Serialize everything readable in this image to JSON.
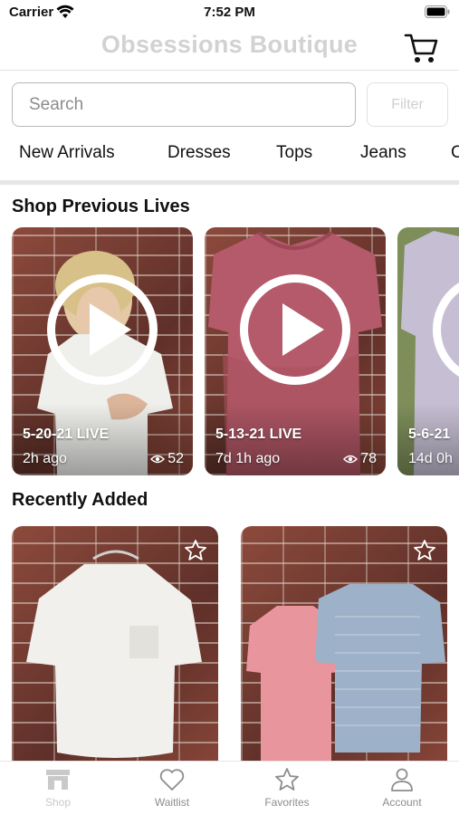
{
  "status_bar": {
    "carrier": "Carrier",
    "time": "7:52 PM"
  },
  "header": {
    "title": "Obsessions Boutique",
    "cart_icon": "cart-icon"
  },
  "search": {
    "placeholder": "Search",
    "value": "",
    "filter_label": "Filter"
  },
  "categories": [
    "New Arrivals",
    "Dresses",
    "Tops",
    "Jeans",
    "C"
  ],
  "sections": {
    "lives_title": "Shop Previous Lives",
    "recent_title": "Recently Added"
  },
  "lives": [
    {
      "label": "5-20-21 LIVE",
      "age": "2h ago",
      "views": "52"
    },
    {
      "label": "5-13-21 LIVE",
      "age": "7d 1h ago",
      "views": "78"
    },
    {
      "label": "5-6-21",
      "age": "14d 0h",
      "views": ""
    }
  ],
  "products": [
    {
      "favorite_icon": "star-icon",
      "favorited": false
    },
    {
      "favorite_icon": "star-icon",
      "favorited": false
    }
  ],
  "tabs": [
    {
      "label": "Shop",
      "icon": "shop-icon",
      "active": true
    },
    {
      "label": "Waitlist",
      "icon": "heart-icon",
      "active": false
    },
    {
      "label": "Favorites",
      "icon": "star-icon",
      "active": false
    },
    {
      "label": "Account",
      "icon": "person-icon",
      "active": false
    }
  ],
  "colors": {
    "title_gray": "#d2d2d2",
    "inactive_tab": "#8d8d8d",
    "active_tab": "#c9c9c9"
  }
}
